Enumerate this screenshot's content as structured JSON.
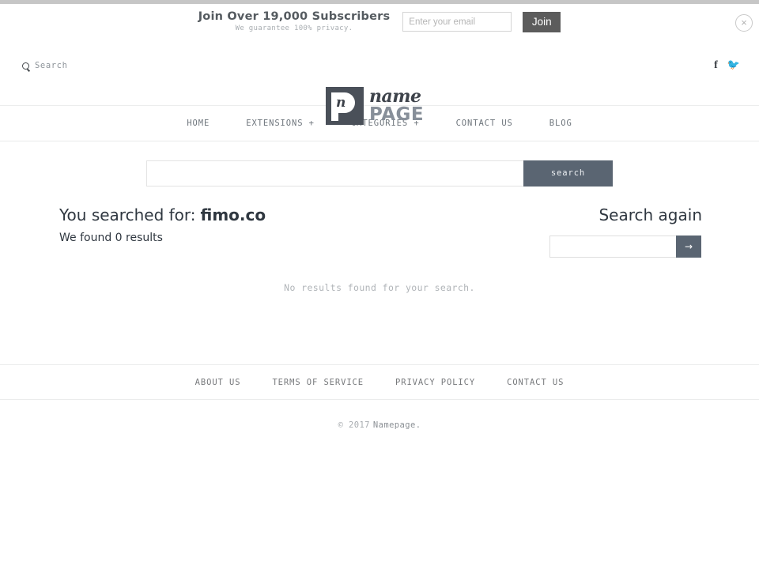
{
  "optin": {
    "headline": "Join Over 19,000 Subscribers",
    "subline": "We guarantee 100% privacy.",
    "email_placeholder": "Enter your email",
    "email_value": "",
    "join_label": "Join",
    "close_icon": "×"
  },
  "header": {
    "search_label": "Search",
    "search_icon": "search-icon",
    "logo": {
      "mark_letter": "n",
      "word_script": "name",
      "word_bold": "PAGE"
    },
    "social": [
      {
        "name": "facebook",
        "glyph": "f"
      },
      {
        "name": "twitter",
        "glyph": "🐦"
      }
    ]
  },
  "nav": {
    "items": [
      {
        "label": "HOME"
      },
      {
        "label": "EXTENSIONS +"
      },
      {
        "label": "CATEGORIES +"
      },
      {
        "label": "CONTACT US"
      },
      {
        "label": "BLOG"
      }
    ]
  },
  "search_bar": {
    "value": "",
    "placeholder": "",
    "button_label": "search"
  },
  "results": {
    "searched_prefix": "You searched for:",
    "query": "fimo.co",
    "found_line": "We found 0 results",
    "empty_message": "No results found for your search."
  },
  "search_again": {
    "title": "Search again",
    "value": "",
    "placeholder": "",
    "submit_glyph": "→"
  },
  "footer": {
    "links": [
      {
        "label": "ABOUT US"
      },
      {
        "label": "TERMS OF SERVICE"
      },
      {
        "label": "PRIVACY POLICY"
      },
      {
        "label": "CONTACT US"
      }
    ],
    "copyright": "© 2017",
    "brand": "Namepage."
  },
  "colors": {
    "accent": "#5a6572",
    "join_button": "#5c5c5c",
    "logo_mark": "#4a5059",
    "logo_page": "#878f99",
    "text_dark": "#2f3740",
    "text_muted": "#b0b4b8"
  }
}
